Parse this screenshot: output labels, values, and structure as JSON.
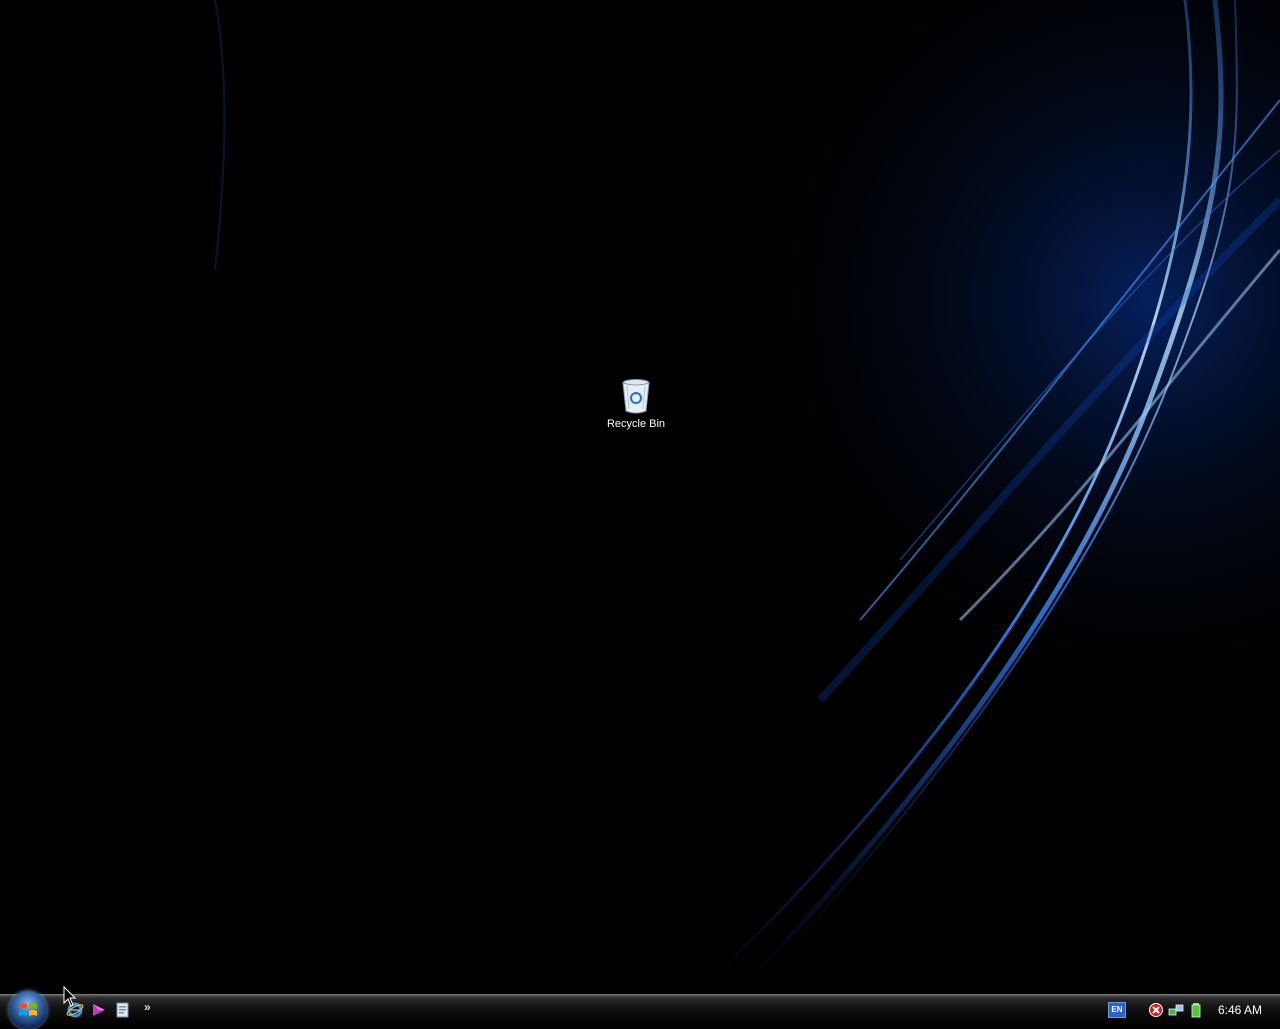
{
  "desktop": {
    "wallpaper": "aurora-blue-swirl",
    "accent_color": "#1e6fff",
    "icons": [
      {
        "label": "Recycle Bin",
        "icon": "recycle-bin-icon"
      }
    ]
  },
  "taskbar": {
    "start_button": {
      "icon": "windows-start-orb-icon"
    },
    "quick_launch": [
      {
        "icon": "internet-explorer-icon"
      },
      {
        "icon": "media-player-icon"
      },
      {
        "icon": "show-desktop-icon"
      }
    ],
    "quick_launch_overflow": "»",
    "tray": {
      "language": "EN",
      "icons": [
        {
          "icon": "security-alert-icon"
        },
        {
          "icon": "network-icon"
        },
        {
          "icon": "battery-icon"
        }
      ],
      "clock": "6:46 AM"
    }
  }
}
